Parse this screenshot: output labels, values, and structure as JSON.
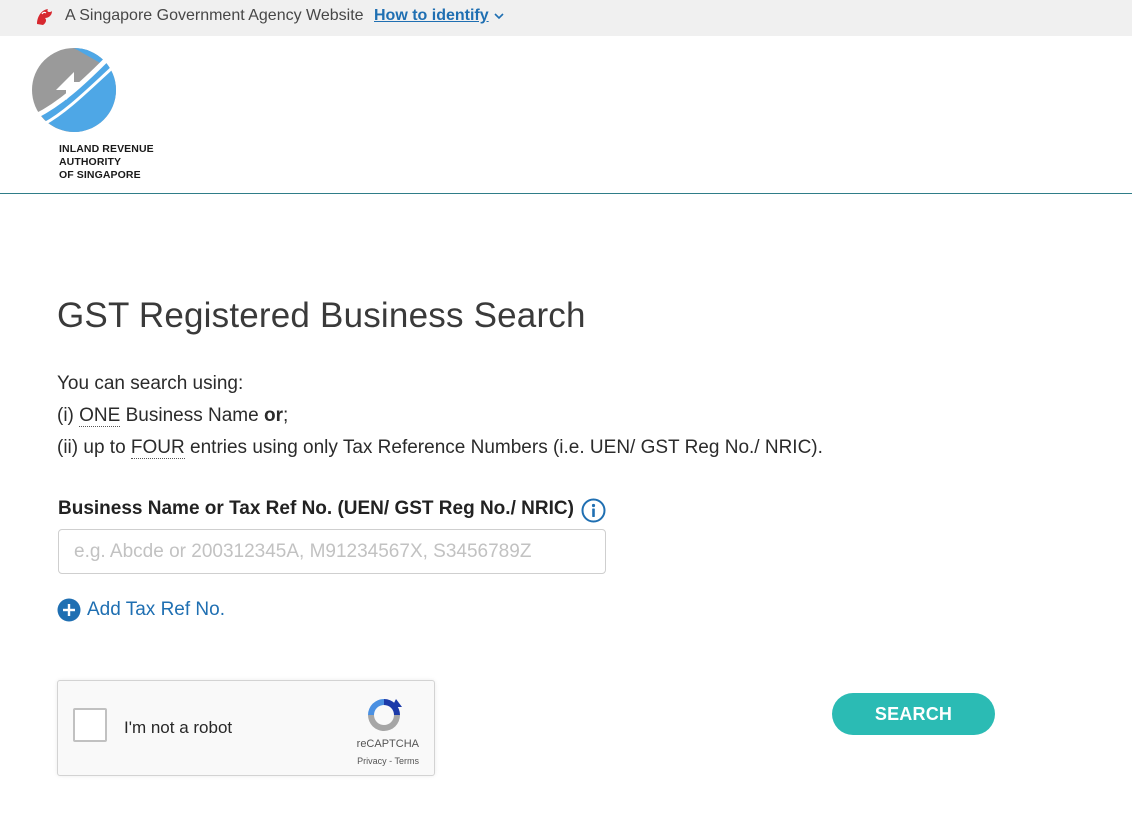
{
  "masthead": {
    "text": "A Singapore Government Agency Website",
    "identify_link": "How to identify",
    "lion_icon": "singapore-lion-icon",
    "chevron_icon": "chevron-down-icon"
  },
  "header": {
    "logo_icon": "iras-logo-icon",
    "logo_lines": [
      "INLAND REVENUE",
      "AUTHORITY",
      "OF SINGAPORE"
    ]
  },
  "main": {
    "title": "GST Registered Business Search",
    "intro": {
      "line1": "You can search using:",
      "line2_prefix": "(i) ",
      "line2_emph": "ONE",
      "line2_mid": " Business Name ",
      "line2_bold": "or",
      "line2_suffix": ";",
      "line3_prefix": "(ii) up to ",
      "line3_emph": "FOUR",
      "line3_suffix": " entries using only Tax Reference Numbers (i.e. UEN/ GST Reg No./ NRIC)."
    },
    "field_label": "Business Name or Tax Ref No. (UEN/ GST Reg No./ NRIC)",
    "info_icon": "info-icon",
    "input": {
      "value": "",
      "placeholder": "e.g. Abcde or 200312345A, M91234567X, S3456789Z"
    },
    "add_link": {
      "label": "Add Tax Ref No.",
      "icon": "plus-circle-icon"
    },
    "recaptcha": {
      "label": "I'm not a robot",
      "brand": "reCAPTCHA",
      "privacy": "Privacy",
      "separator": " - ",
      "terms": "Terms",
      "logo_icon": "recaptcha-logo-icon"
    },
    "search_button": "SEARCH"
  },
  "colors": {
    "accent_teal": "#2bbbb4",
    "link_blue": "#1f6fb2",
    "masthead_bg": "#f0f0f0",
    "header_rule": "#2f7d88"
  }
}
